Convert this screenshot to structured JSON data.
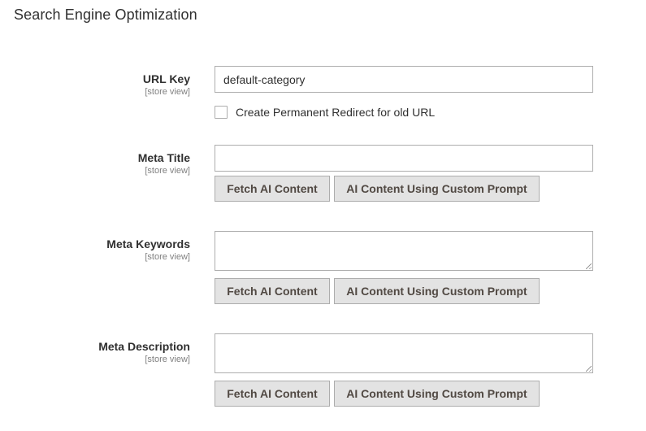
{
  "section": {
    "title": "Search Engine Optimization"
  },
  "fields": {
    "url_key": {
      "label": "URL Key",
      "scope": "[store view]",
      "value": "default-category"
    },
    "redirect": {
      "label": "Create Permanent Redirect for old URL",
      "checked": false
    },
    "meta_title": {
      "label": "Meta Title",
      "scope": "[store view]",
      "value": ""
    },
    "meta_keywords": {
      "label": "Meta Keywords",
      "scope": "[store view]",
      "value": ""
    },
    "meta_description": {
      "label": "Meta Description",
      "scope": "[store view]",
      "value": ""
    }
  },
  "buttons": {
    "fetch_label": "Fetch AI Content",
    "custom_label": "AI Content Using Custom Prompt"
  },
  "colors": {
    "button_bg": "#e3e3e3",
    "button_text": "#514943",
    "border": "#adadad",
    "scope_text": "#808080"
  }
}
